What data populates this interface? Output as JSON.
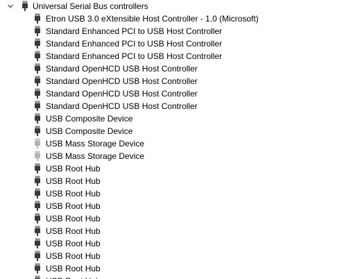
{
  "tree": {
    "category_label": "Universal Serial Bus controllers",
    "devices": [
      {
        "label": "Etron USB 3.0 eXtensible Host Controller - 1.0 (Microsoft)",
        "icon": "usb-connector-icon",
        "disabled": false
      },
      {
        "label": "Standard Enhanced PCI to USB Host Controller",
        "icon": "usb-connector-icon",
        "disabled": false
      },
      {
        "label": "Standard Enhanced PCI to USB Host Controller",
        "icon": "usb-connector-icon",
        "disabled": false
      },
      {
        "label": "Standard Enhanced PCI to USB Host Controller",
        "icon": "usb-connector-icon",
        "disabled": false
      },
      {
        "label": "Standard OpenHCD USB Host Controller",
        "icon": "usb-connector-icon",
        "disabled": false
      },
      {
        "label": "Standard OpenHCD USB Host Controller",
        "icon": "usb-connector-icon",
        "disabled": false
      },
      {
        "label": "Standard OpenHCD USB Host Controller",
        "icon": "usb-connector-icon",
        "disabled": false
      },
      {
        "label": "Standard OpenHCD USB Host Controller",
        "icon": "usb-connector-icon",
        "disabled": false
      },
      {
        "label": "USB Composite Device",
        "icon": "usb-connector-icon",
        "disabled": false
      },
      {
        "label": "USB Composite Device",
        "icon": "usb-connector-icon",
        "disabled": false
      },
      {
        "label": "USB Mass Storage Device",
        "icon": "usb-connector-icon",
        "disabled": true
      },
      {
        "label": "USB Mass Storage Device",
        "icon": "usb-connector-icon",
        "disabled": true
      },
      {
        "label": "USB Root Hub",
        "icon": "usb-connector-icon",
        "disabled": false
      },
      {
        "label": "USB Root Hub",
        "icon": "usb-connector-icon",
        "disabled": false
      },
      {
        "label": "USB Root Hub",
        "icon": "usb-connector-icon",
        "disabled": false
      },
      {
        "label": "USB Root Hub",
        "icon": "usb-connector-icon",
        "disabled": false
      },
      {
        "label": "USB Root Hub",
        "icon": "usb-connector-icon",
        "disabled": false
      },
      {
        "label": "USB Root Hub",
        "icon": "usb-connector-icon",
        "disabled": false
      },
      {
        "label": "USB Root Hub",
        "icon": "usb-connector-icon",
        "disabled": false
      },
      {
        "label": "USB Root Hub",
        "icon": "usb-connector-icon",
        "disabled": false
      },
      {
        "label": "USB Root Hub",
        "icon": "usb-connector-icon",
        "disabled": false
      },
      {
        "label": "USB Root Hub",
        "icon": "usb-connector-icon",
        "disabled": false
      }
    ]
  },
  "colors": {
    "text": "#000000",
    "icon_enabled": "#3a3a3a",
    "icon_disabled": "#b4b4b4"
  }
}
